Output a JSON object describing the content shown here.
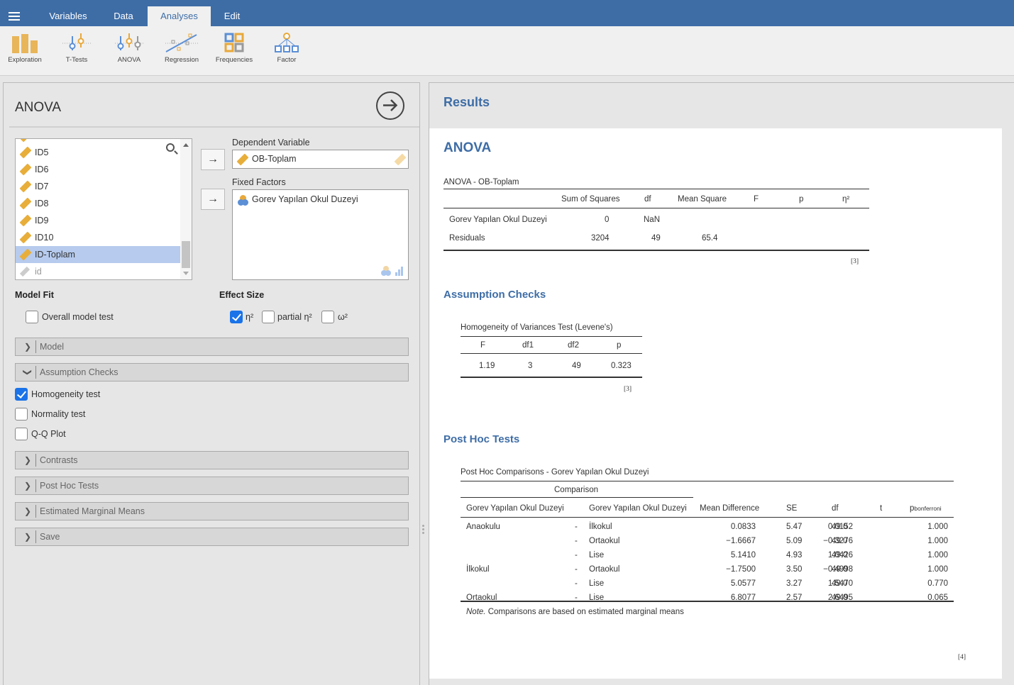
{
  "topbar": {
    "tabs": [
      {
        "label": "Variables",
        "active": false
      },
      {
        "label": "Data",
        "active": false
      },
      {
        "label": "Analyses",
        "active": true
      },
      {
        "label": "Edit",
        "active": false
      }
    ],
    "accent_color": "#3e6da6"
  },
  "ribbon": {
    "buttons": [
      {
        "label": "Exploration",
        "icon": "bar-chart-icon"
      },
      {
        "label": "T-Tests",
        "icon": "ttest-icon"
      },
      {
        "label": "ANOVA",
        "icon": "anova-icon"
      },
      {
        "label": "Regression",
        "icon": "regression-icon"
      },
      {
        "label": "Frequencies",
        "icon": "frequencies-icon"
      },
      {
        "label": "Factor",
        "icon": "factor-icon"
      }
    ]
  },
  "analysis_panel": {
    "title": "ANOVA",
    "variables": [
      {
        "name": "ID5",
        "type": "continuous",
        "selected": false
      },
      {
        "name": "ID6",
        "type": "continuous",
        "selected": false
      },
      {
        "name": "ID7",
        "type": "continuous",
        "selected": false
      },
      {
        "name": "ID8",
        "type": "continuous",
        "selected": false
      },
      {
        "name": "ID9",
        "type": "continuous",
        "selected": false
      },
      {
        "name": "ID10",
        "type": "continuous",
        "selected": false
      },
      {
        "name": "ID-Toplam",
        "type": "continuous",
        "selected": true
      },
      {
        "name": "id",
        "type": "id",
        "selected": false
      }
    ],
    "dependent_variable": {
      "label": "Dependent Variable",
      "value": "OB-Toplam"
    },
    "fixed_factors": {
      "label": "Fixed Factors",
      "values": [
        "Gorev Yapılan Okul Duzeyi"
      ]
    },
    "move_arrow": "→",
    "model_fit": {
      "label": "Model Fit",
      "overall_model_test": {
        "label": "Overall model test",
        "checked": false
      }
    },
    "effect_size": {
      "label": "Effect Size",
      "eta_sq": {
        "label": "η²",
        "checked": true
      },
      "partial_eta_sq": {
        "label": "partial η²",
        "checked": false
      },
      "omega_sq": {
        "label": "ω²",
        "checked": false
      }
    },
    "sections": {
      "model": {
        "label": "Model",
        "expanded": false
      },
      "assumption_checks": {
        "label": "Assumption Checks",
        "expanded": true
      },
      "contrasts": {
        "label": "Contrasts",
        "expanded": false
      },
      "post_hoc": {
        "label": "Post Hoc Tests",
        "expanded": false
      },
      "emm": {
        "label": "Estimated Marginal Means",
        "expanded": false
      },
      "save": {
        "label": "Save",
        "expanded": false
      }
    },
    "assumption_options": {
      "homogeneity": {
        "label": "Homogeneity test",
        "checked": true
      },
      "normality": {
        "label": "Normality test",
        "checked": false
      },
      "qq": {
        "label": "Q-Q Plot",
        "checked": false
      }
    }
  },
  "results": {
    "header": "Results",
    "anova": {
      "heading": "ANOVA",
      "table_title": "ANOVA - OB-Toplam",
      "columns": [
        "",
        "Sum of Squares",
        "df",
        "Mean Square",
        "F",
        "p",
        "η²"
      ],
      "rows": [
        [
          "Gorev Yapılan Okul Duzeyi",
          "0",
          "NaN",
          "",
          "",
          "",
          ""
        ],
        [
          "Residuals",
          "3204",
          "49",
          "65.4",
          "",
          "",
          ""
        ]
      ],
      "ref": "[3]"
    },
    "assumption_checks": {
      "heading": "Assumption Checks",
      "table_title": "Homogeneity of Variances Test (Levene's)",
      "columns": [
        "F",
        "df1",
        "df2",
        "p"
      ],
      "rows": [
        [
          "1.19",
          "3",
          "49",
          "0.323"
        ]
      ],
      "ref": "[3]"
    },
    "post_hoc": {
      "heading": "Post Hoc Tests",
      "table_title": "Post Hoc Comparisons - Gorev Yapılan Okul Duzeyi",
      "group_header": "Comparison",
      "columns": [
        "Gorev Yapılan Okul Duzeyi",
        "",
        "Gorev Yapılan Okul Duzeyi",
        "Mean Difference",
        "SE",
        "df",
        "t",
        "p"
      ],
      "p_subscript": "bonferroni",
      "rows": [
        [
          "Anaokulu",
          "-",
          "İlkokul",
          "0.0833",
          "5.47",
          "49.0",
          "0.0152",
          "1.000"
        ],
        [
          "",
          "-",
          "Ortaokul",
          "−1.6667",
          "5.09",
          "49.0",
          "−0.3276",
          "1.000"
        ],
        [
          "",
          "-",
          "Lise",
          "5.1410",
          "4.93",
          "49.0",
          "1.0426",
          "1.000"
        ],
        [
          "İlkokul",
          "-",
          "Ortaokul",
          "−1.7500",
          "3.50",
          "49.0",
          "−0.4998",
          "1.000"
        ],
        [
          "",
          "-",
          "Lise",
          "5.0577",
          "3.27",
          "49.0",
          "1.5470",
          "0.770"
        ],
        [
          "Ortaokul",
          "-",
          "Lise",
          "6.8077",
          "2.57",
          "49.0",
          "2.6495",
          "0.065"
        ]
      ],
      "note_italic": "Note.",
      "note_text": " Comparisons are based on estimated marginal means",
      "ref": "[4]"
    }
  }
}
